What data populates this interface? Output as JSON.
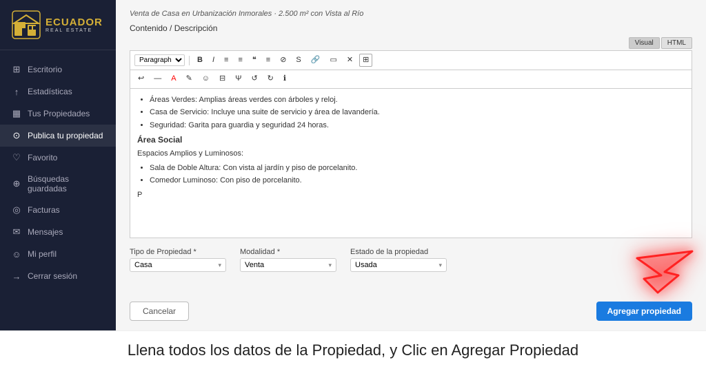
{
  "sidebar": {
    "logo": {
      "main": "ECUADOR",
      "sub": "REAL ESTATE"
    },
    "items": [
      {
        "id": "escritorio",
        "label": "Escritorio",
        "icon": "⊞"
      },
      {
        "id": "estadisticas",
        "label": "Estadísticas",
        "icon": "↑"
      },
      {
        "id": "tus-propiedades",
        "label": "Tus Propiedades",
        "icon": "▦"
      },
      {
        "id": "publica-tu-propiedad",
        "label": "Publica tu propiedad",
        "icon": "⊙",
        "active": true
      },
      {
        "id": "favorito",
        "label": "Favorito",
        "icon": "♡"
      },
      {
        "id": "busquedas-guardadas",
        "label": "Búsquedas guardadas",
        "icon": "⊕"
      },
      {
        "id": "facturas",
        "label": "Facturas",
        "icon": "◎"
      },
      {
        "id": "mensajes",
        "label": "Mensajes",
        "icon": "✉"
      },
      {
        "id": "mi-perfil",
        "label": "Mi perfil",
        "icon": "☺"
      },
      {
        "id": "cerrar-sesion",
        "label": "Cerrar sesión",
        "icon": "→"
      }
    ]
  },
  "page_title": "Venta de Casa en Urbanización Inmorales · 2.500 m² con Vista al Río",
  "content_label": "Contenido / Descripción",
  "view_toggle": {
    "visual": "Visual",
    "html": "HTML"
  },
  "toolbar": {
    "font_select": "Paragraph",
    "buttons": [
      "B",
      "I",
      "≡",
      "≡",
      "\"",
      "≡",
      "⊘",
      "S",
      "🔗",
      "▭",
      "×",
      "▦"
    ]
  },
  "editor_content": {
    "bullet1": "Áreas Verdes: Amplias áreas verdes con árboles y reloj.",
    "bullet2": "Casa de Servicio: Incluye una suite de servicio y área de lavandería.",
    "bullet3": "Seguridad: Garita para guardia y seguridad 24 horas.",
    "heading": "Área Social",
    "subheading": "Espacios Amplios y Luminosos:",
    "bullet4": "Sala de Doble Altura: Con vista al jardín y piso de porcelanito.",
    "bullet5": "Comedor Luminoso: Con piso de porcelanito.",
    "paragraph": "P"
  },
  "form": {
    "field1_label": "Tipo de Propiedad *",
    "field1_value": "Casa",
    "field2_label": "Modalidad *",
    "field2_value": "Venta",
    "field3_label": "Estado de la propiedad",
    "field3_value": "Usada"
  },
  "actions": {
    "cancel": "Cancelar",
    "add": "Agregar propiedad"
  },
  "caption": "Llena todos los datos de la Propiedad, y Clic en Agregar Propiedad"
}
